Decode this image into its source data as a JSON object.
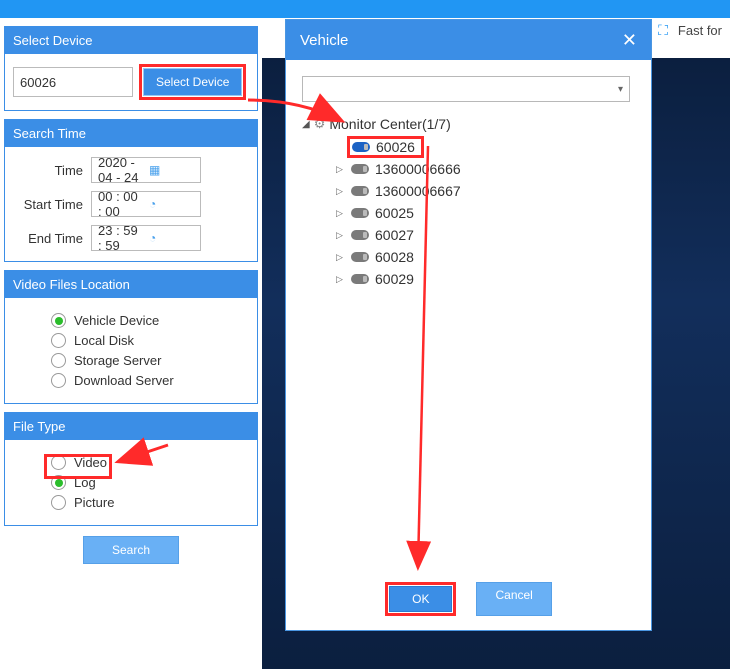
{
  "toolbar": {
    "fast_forward": "Fast for"
  },
  "panels": {
    "select_device": {
      "title": "Select Device",
      "value": "60026",
      "button": "Select Device"
    },
    "search_time": {
      "title": "Search Time",
      "time_label": "Time",
      "time_value": "2020 - 04 - 24",
      "start_label": "Start Time",
      "start_value": "00 : 00 : 00",
      "end_label": "End Time",
      "end_value": "23 : 59 : 59"
    },
    "video_location": {
      "title": "Video Files Location",
      "options": [
        "Vehicle Device",
        "Local Disk",
        "Storage Server",
        "Download Server"
      ],
      "selected": 0
    },
    "file_type": {
      "title": "File Type",
      "options": [
        "Video",
        "Log",
        "Picture"
      ],
      "selected": 1
    },
    "search_button": "Search"
  },
  "dialog": {
    "title": "Vehicle",
    "root": "Monitor Center(1/7)",
    "items": [
      "60026",
      "13600006666",
      "13600006667",
      "60025",
      "60027",
      "60028",
      "60029"
    ],
    "selected_index": 0,
    "ok": "OK",
    "cancel": "Cancel"
  }
}
